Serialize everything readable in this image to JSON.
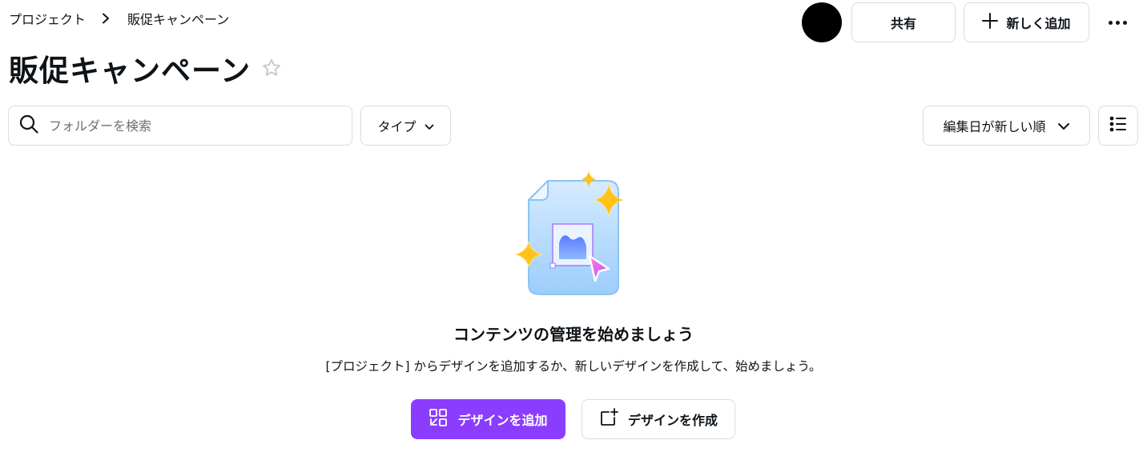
{
  "breadcrumb": {
    "items": [
      "プロジェクト",
      "販促キャンペーン"
    ]
  },
  "header": {
    "share_label": "共有",
    "add_new_label": "新しく追加"
  },
  "page": {
    "title": "販促キャンペーン"
  },
  "toolbar": {
    "search_placeholder": "フォルダーを検索",
    "type_label": "タイプ",
    "sort_label": "編集日が新しい順"
  },
  "empty_state": {
    "title": "コンテンツの管理を始めましょう",
    "description": "[プロジェクト] からデザインを追加するか、新しいデザインを作成して、始めましょう。",
    "add_design_label": "デザインを追加",
    "create_design_label": "デザインを作成"
  },
  "colors": {
    "accent": "#8b3dff",
    "border": "#d9dce0",
    "text": "#0e1318"
  },
  "icons": [
    "chevron-right-icon",
    "plus-icon",
    "more-icon",
    "star-icon",
    "search-icon",
    "chevron-down-icon",
    "list-view-icon",
    "add-design-icon",
    "create-design-icon"
  ]
}
